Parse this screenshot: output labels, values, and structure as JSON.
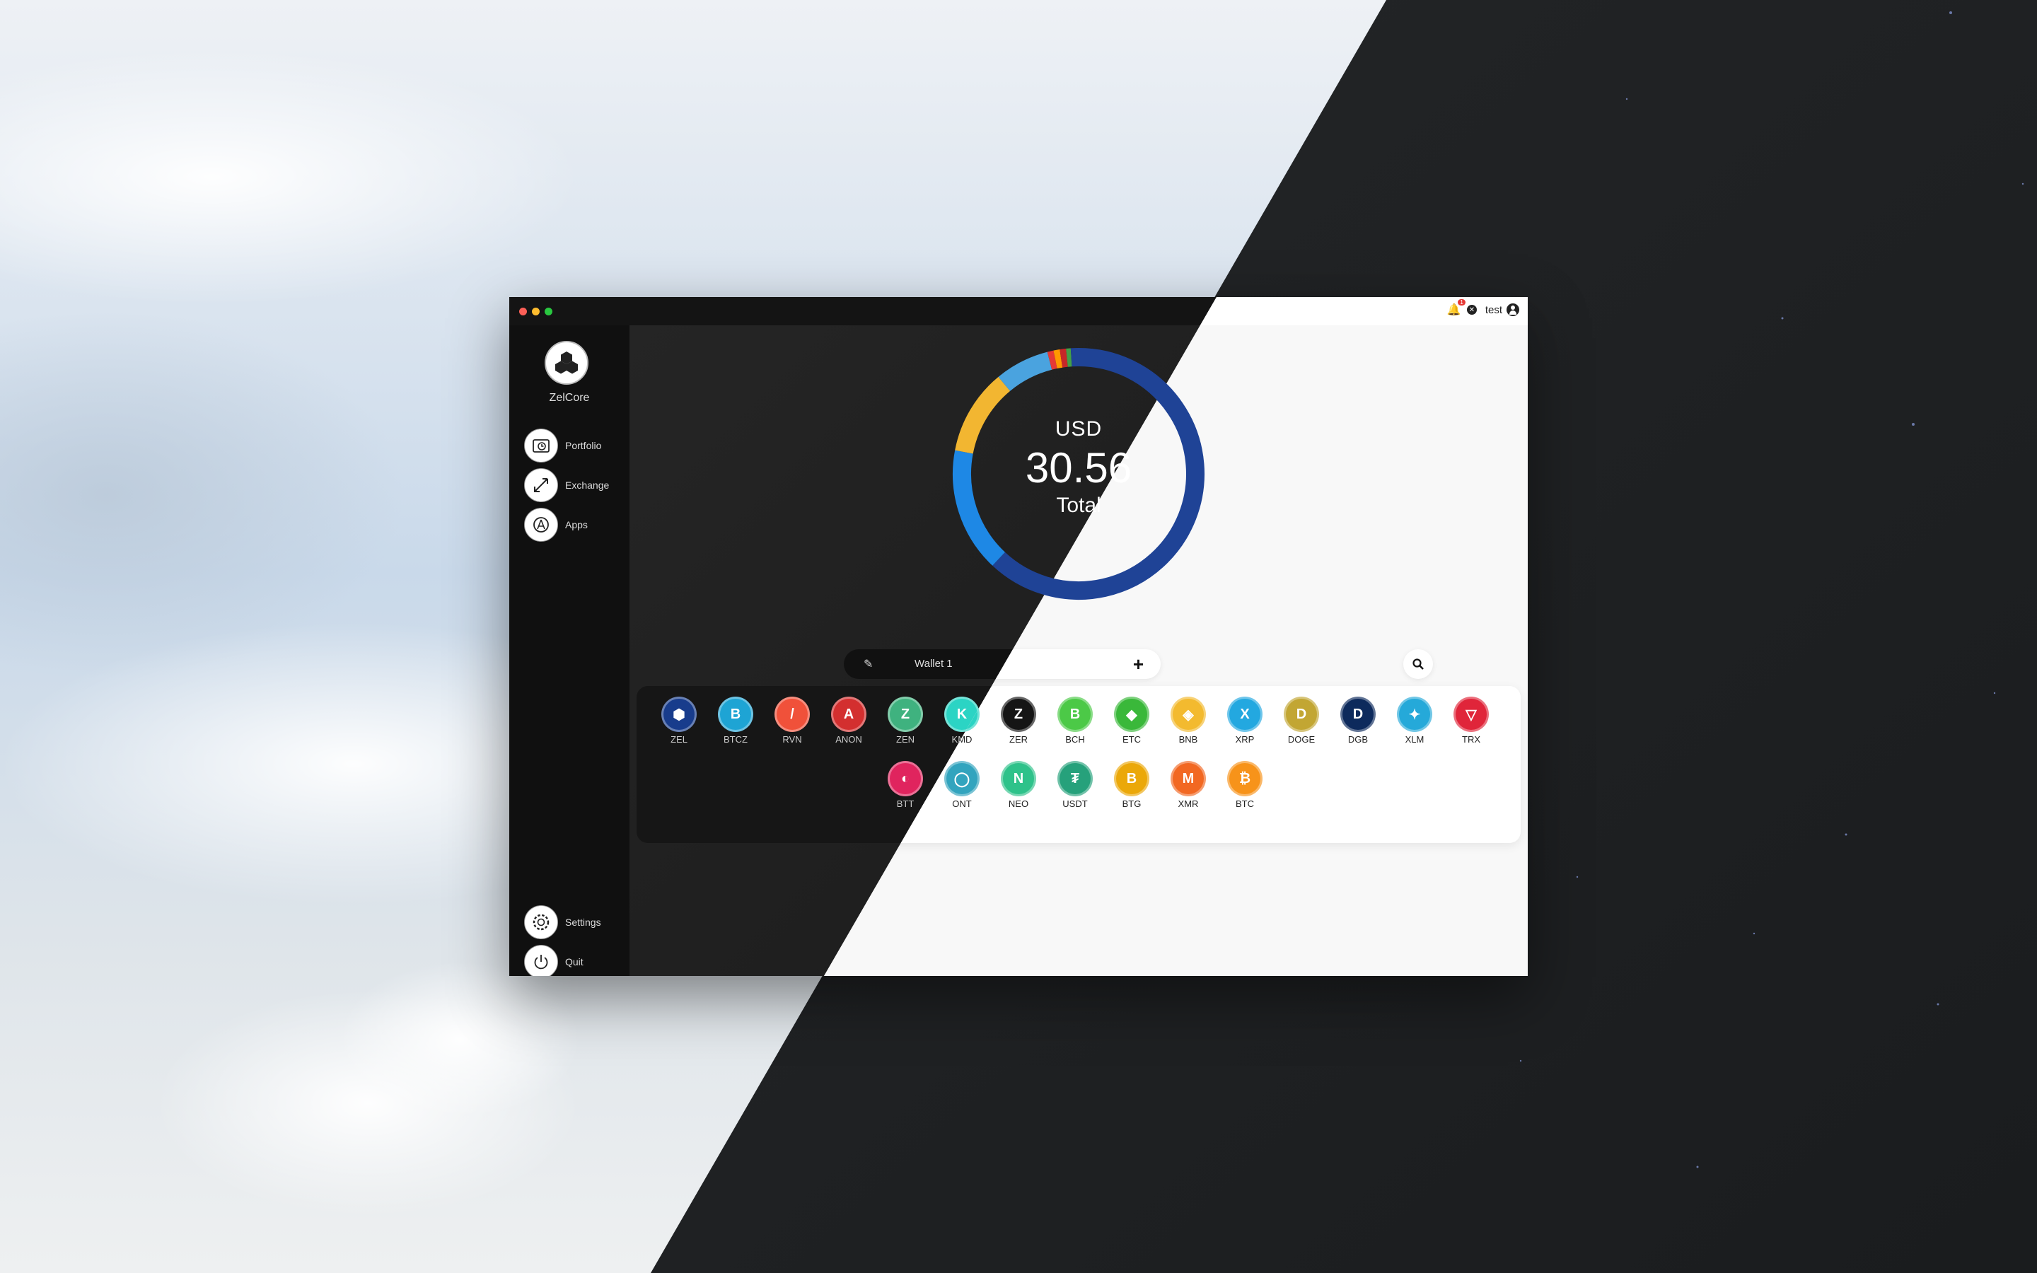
{
  "app": {
    "name": "ZelCore",
    "user": "test",
    "notification_count": "1"
  },
  "nav": {
    "items": [
      {
        "label": "Portfolio",
        "icon": "portfolio-icon"
      },
      {
        "label": "Exchange",
        "icon": "exchange-icon"
      },
      {
        "label": "Apps",
        "icon": "apps-icon"
      }
    ],
    "bottom_items": [
      {
        "label": "Settings",
        "icon": "gear-icon"
      },
      {
        "label": "Quit",
        "icon": "power-icon"
      }
    ]
  },
  "portfolio": {
    "currency": "USD",
    "total": "30.56",
    "total_label": "Total"
  },
  "wallet": {
    "name": "Wallet 1"
  },
  "chart_data": {
    "type": "pie",
    "donut": true,
    "slices_percent": [
      {
        "value": 62,
        "color": "#1f4396"
      },
      {
        "value": 16,
        "color": "#1e88e5"
      },
      {
        "value": 11,
        "color": "#f2b631"
      },
      {
        "value": 7,
        "color": "#4aa3df"
      },
      {
        "value": 0.8,
        "color": "#e53935"
      },
      {
        "value": 0.8,
        "color": "#ff9800"
      },
      {
        "value": 0.8,
        "color": "#c62828"
      },
      {
        "value": 0.6,
        "color": "#43a047"
      },
      {
        "value": 1.0,
        "color": "#1f4396"
      }
    ]
  },
  "coins": [
    {
      "symbol": "ZEL",
      "color": "#183c8c",
      "glyph": "⬢"
    },
    {
      "symbol": "BTCZ",
      "color": "#1ea4d4",
      "glyph": "B"
    },
    {
      "symbol": "RVN",
      "color": "#f0513a",
      "glyph": "/"
    },
    {
      "symbol": "ANON",
      "color": "#d32f2f",
      "glyph": "A"
    },
    {
      "symbol": "ZEN",
      "color": "#3fb27f",
      "glyph": "Z"
    },
    {
      "symbol": "KMD",
      "color": "#2bd4c4",
      "glyph": "K"
    },
    {
      "symbol": "ZER",
      "color": "#151515",
      "glyph": "Z"
    },
    {
      "symbol": "BCH",
      "color": "#4cc947",
      "glyph": "B"
    },
    {
      "symbol": "ETC",
      "color": "#3ab83a",
      "glyph": "◆"
    },
    {
      "symbol": "BNB",
      "color": "#f3ba2f",
      "glyph": "◈"
    },
    {
      "symbol": "XRP",
      "color": "#23a8e0",
      "glyph": "X"
    },
    {
      "symbol": "DOGE",
      "color": "#c2a633",
      "glyph": "D"
    },
    {
      "symbol": "DGB",
      "color": "#0d2a5c",
      "glyph": "D"
    },
    {
      "symbol": "XLM",
      "color": "#25a9d9",
      "glyph": "✦"
    },
    {
      "symbol": "TRX",
      "color": "#e0253a",
      "glyph": "▽"
    },
    {
      "symbol": "BTT",
      "color": "#e0245e",
      "glyph": "◐"
    },
    {
      "symbol": "ONT",
      "color": "#32a4be",
      "glyph": "◯"
    },
    {
      "symbol": "NEO",
      "color": "#2ec28a",
      "glyph": "N"
    },
    {
      "symbol": "USDT",
      "color": "#26a17b",
      "glyph": "₮"
    },
    {
      "symbol": "BTG",
      "color": "#eba809",
      "glyph": "B"
    },
    {
      "symbol": "XMR",
      "color": "#f26822",
      "glyph": "M"
    },
    {
      "symbol": "BTC",
      "color": "#f7931a",
      "glyph": "₿"
    }
  ]
}
